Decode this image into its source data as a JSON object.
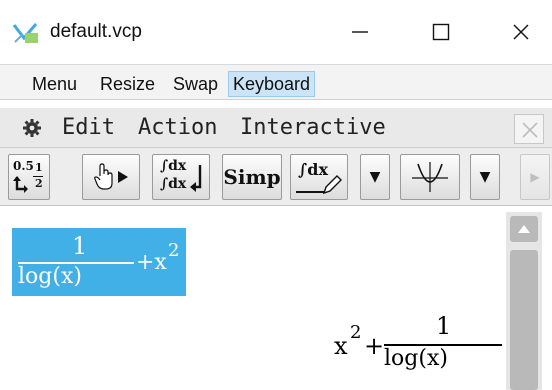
{
  "window": {
    "title": "default.vcp",
    "minimize_icon": "minimize-icon",
    "maximize_icon": "maximize-icon",
    "close_icon": "close-icon"
  },
  "menubar": {
    "items": [
      {
        "label": "Menu"
      },
      {
        "label": "Resize"
      },
      {
        "label": "Swap"
      },
      {
        "label": "Keyboard",
        "active": true
      }
    ]
  },
  "classpad_menu": {
    "items": [
      {
        "label": "Edit"
      },
      {
        "label": "Action"
      },
      {
        "label": "Interactive"
      }
    ],
    "gear_icon": "gear-icon",
    "close_icon": "close-icon"
  },
  "toolbar": {
    "decimal_top": "0.5",
    "decimal_frac_num": "1",
    "decimal_frac_den": "2",
    "integral_top": "∫dx",
    "integral_bottom": "∫dx",
    "simp_label": "Simp",
    "integrate_label": "∫dx",
    "dropdown_glyph": "▼",
    "play_glyph": "▶"
  },
  "input_expression": {
    "numerator": "1",
    "denominator": "log(x)",
    "plus_term": "+x",
    "exponent": "2"
  },
  "output_expression": {
    "base": "x",
    "exponent": "2",
    "plus": "+",
    "numerator": "1",
    "denominator": "log(x)"
  },
  "colors": {
    "selection": "#41b0e6",
    "menu_active": "#cce4f7"
  }
}
